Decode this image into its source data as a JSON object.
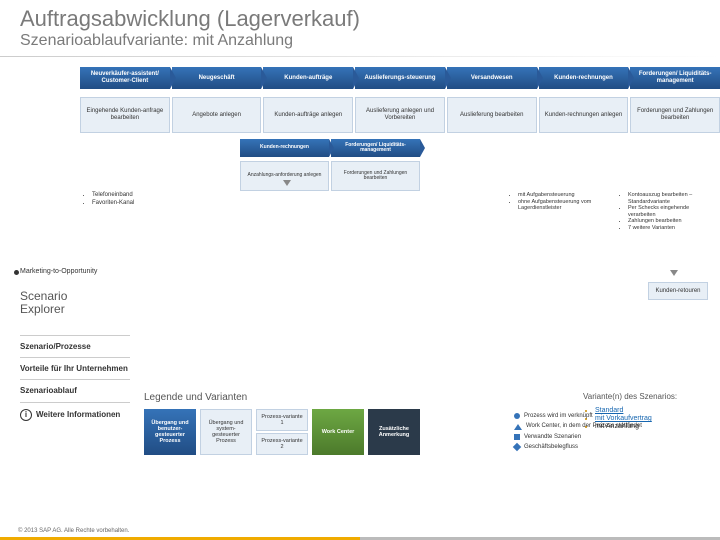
{
  "header": {
    "title": "Auftragsabwicklung (Lagerverkauf)",
    "subtitle": "Szenarioablaufvariante: mit Anzahlung"
  },
  "phases": [
    "Neuverkäufer-assistent/ Customer-Client",
    "Neugeschäft",
    "Kunden-aufträge",
    "Auslieferungs-steuerung",
    "Versandwesen",
    "Kunden-rechnungen",
    "Forderungen/ Liquiditäts-management"
  ],
  "steps": [
    "Eingehende Kunden-anfrage bearbeiten",
    "Angebote anlegen",
    "Kunden-aufträge anlegen",
    "Auslieferung anlegen und Vorbereiten",
    "Auslieferung bearbeiten",
    "Kunden-rechnungen anlegen",
    "Forderungen und Zahlungen bearbeiten"
  ],
  "notes_left": [
    "Telefoneinband",
    "Favoriten-Kanal"
  ],
  "notes_mid": [
    "mit Aufgabensteuerung",
    "ohne Aufgabensteuerung vom Lagerdienstleister"
  ],
  "notes_right": [
    "Kontoauszug bearbeiten – Standardvariante",
    "Per Schecks eingehende verarbeiten",
    "Zahlungen bearbeiten",
    "7 weitere Varianten"
  ],
  "mini_phases": [
    "Kunden-rechnungen",
    "Forderungen/ Liquiditäts-management"
  ],
  "mini_steps": [
    "Anzahlungs-anforderung anlegen",
    "Forderungen und Zahlungen bearbeiten"
  ],
  "retour": "Kunden-retouren",
  "marketing": "Marketing-to-Opportunity",
  "scenario_explorer": "Scenario\nExplorer",
  "sidebar": {
    "item1": "Szenario/Prozesse",
    "item2": "Vorteile für Ihr Unternehmen",
    "item3": "Szenarioablauf",
    "item4": "Weitere Informationen"
  },
  "legend": {
    "title": "Legende und Varianten",
    "boxes": {
      "a": "Übergang und benutzer-gesteuerter Prozess",
      "b": "Übergang und system-gesteuerter Prozess",
      "c1": "Prozess-variante 1",
      "c2": "Prozess-variante 2",
      "d": "Work Center",
      "e": "Zusätzliche Anmerkung"
    },
    "keys": {
      "k1": "Prozess wird im verknüpft",
      "k2": "Work Center, in dem der Prozess stattfindet",
      "k3": "Verwandte Szenarien",
      "k4": "Geschäftsbelegfluss"
    }
  },
  "variants": {
    "title": "Variante(n) des Szenarios:",
    "items": [
      "Standard",
      "mit Vorkaufvertrag",
      "mit Anzahlung"
    ]
  },
  "footer": "© 2013 SAP AG. Alle Rechte vorbehalten."
}
